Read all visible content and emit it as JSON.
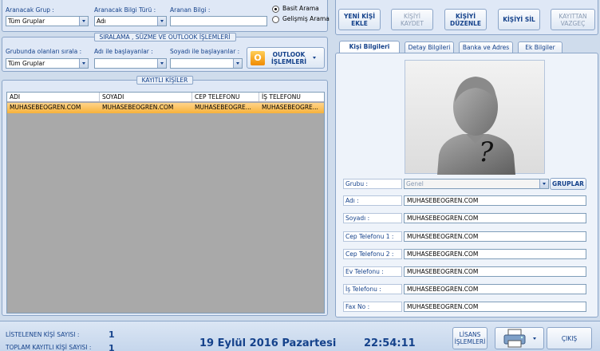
{
  "search": {
    "group_label": "Aranacak Grup :",
    "group_value": "Tüm Gruplar",
    "field_type_label": "Aranacak Bilgi Türü :",
    "field_type_value": "Adı",
    "query_label": "Aranan Bilgi :",
    "mode_basic": "Basit Arama",
    "mode_advanced": "Gelişmiş Arama"
  },
  "filter": {
    "title": "SIRALAMA , SÜZME VE OUTLOOK İŞLEMLERİ",
    "sort_label": "Grubunda olanları sırala :",
    "sort_value": "Tüm Gruplar",
    "name_starts_label": "Adı ile başlayanlar :",
    "surname_starts_label": "Soyadı ile başlayanlar :",
    "outlook_button": "OUTLOOK İŞLEMLERİ"
  },
  "records": {
    "title": "KAYITLI KİŞİLER",
    "columns": [
      "ADI",
      "SOYADI",
      "CEP TELEFONU",
      "İŞ TELEFONU"
    ],
    "rows": [
      [
        "MUHASEBEOGREN.COM",
        "MUHASEBEOGREN.COM",
        "MUHASEBEOGRE...",
        "MUHASEBEOGRE..."
      ]
    ]
  },
  "toolbar": {
    "new": "YENİ KİŞİ EKLE",
    "save": "KİŞİYİ KAYDET",
    "edit": "KİŞİYİ DÜZENLE",
    "delete": "KİŞİYİ SİL",
    "cancel": "KAYITTAN VAZGEÇ"
  },
  "tabs": [
    "Kişi Bilgileri",
    "Detay Bilgileri",
    "Banka ve Adres",
    "Ek Bilgiler"
  ],
  "details": {
    "group_label": "Grubu :",
    "group_value": "Genel",
    "groups_button": "GRUPLAR",
    "fields": [
      {
        "label": "Adı :",
        "value": "MUHASEBEOGREN.COM"
      },
      {
        "label": "Soyadı :",
        "value": "MUHASEBEOGREN.COM"
      },
      {
        "label": "Cep Telefonu 1 :",
        "value": "MUHASEBEOGREN.COM"
      },
      {
        "label": "Cep Telefonu 2 :",
        "value": "MUHASEBEOGREN.COM"
      },
      {
        "label": "Ev Telefonu :",
        "value": "MUHASEBEOGREN.COM"
      },
      {
        "label": "İş Telefonu :",
        "value": "MUHASEBEOGREN.COM"
      },
      {
        "label": "Fax No :",
        "value": "MUHASEBEOGREN.COM"
      }
    ]
  },
  "footer": {
    "listed_label": "LİSTELENEN KİŞİ SAYISI :",
    "listed_value": "1",
    "total_label": "TOPLAM KAYITLI KİŞİ SAYISI :",
    "total_value": "1",
    "date": "19 Eylül 2016 Pazartesi",
    "time": "22:54:11",
    "license_button": "LİSANS İŞLEMLERİ",
    "exit_button": "ÇIKIŞ"
  },
  "icons": {
    "outlook": "outlook-icon",
    "printer": "printer-icon",
    "avatar": "unknown-person-icon"
  }
}
